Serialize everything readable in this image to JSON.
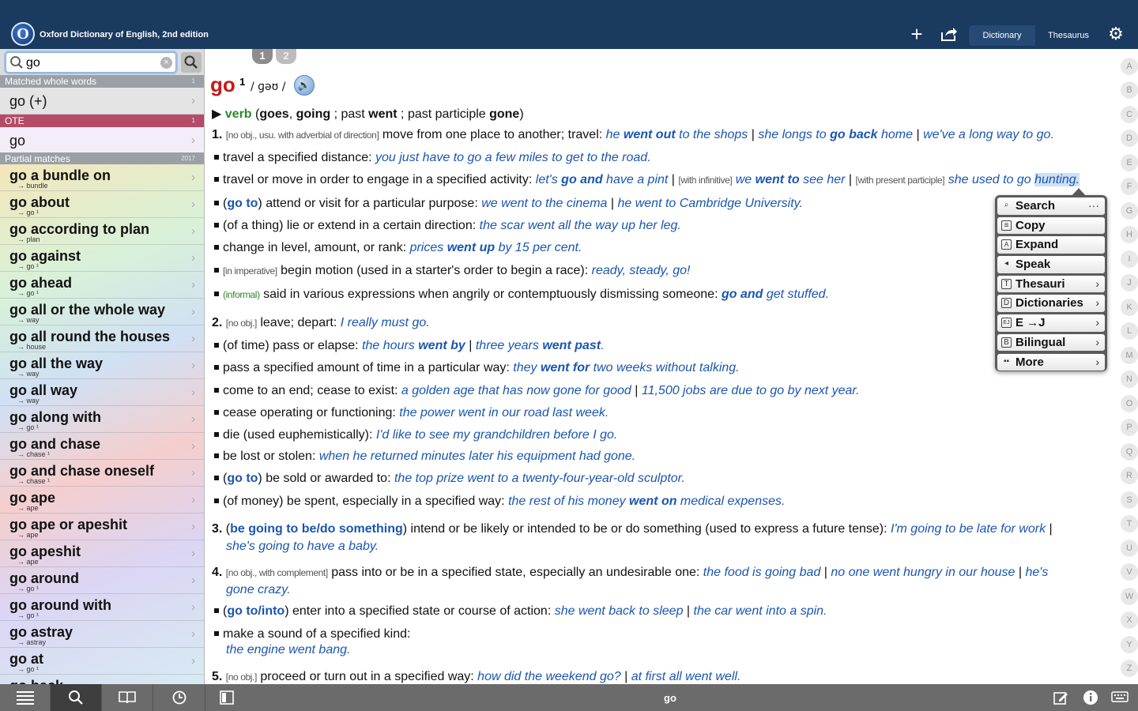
{
  "app": {
    "title": "Oxford Dictionary of English, 2nd edition",
    "logo_letter": "O"
  },
  "toolbar": {
    "tabs": [
      "Dictionary",
      "Thesaurus"
    ],
    "active_tab": "Dictionary"
  },
  "search": {
    "value": "go"
  },
  "sidebar": {
    "sections": [
      {
        "title": "Matched whole words",
        "count": "1",
        "color": "#9aa0a6"
      },
      {
        "title": "OTE",
        "count": "1",
        "color": "#b54b66"
      },
      {
        "title": "Partial matches",
        "count": "2017",
        "color": "#9aa0a6"
      }
    ],
    "matched": "go (+)",
    "ote": "go",
    "partial": [
      {
        "main": "go a bundle on",
        "sub": "→ bundle"
      },
      {
        "main": "go about",
        "sub": "→ go ¹"
      },
      {
        "main": "go according to plan",
        "sub": "→ plan"
      },
      {
        "main": "go against",
        "sub": "→ go ¹"
      },
      {
        "main": "go ahead",
        "sub": "→ go ¹"
      },
      {
        "main": "go all or the whole way",
        "sub": "→ way"
      },
      {
        "main": "go all round the houses",
        "sub": "→ house"
      },
      {
        "main": "go all the way",
        "sub": "→ way"
      },
      {
        "main": "go all way",
        "sub": "→ way"
      },
      {
        "main": "go along with",
        "sub": "→ go ¹"
      },
      {
        "main": "go and chase",
        "sub": "→ chase ¹"
      },
      {
        "main": "go and chase oneself",
        "sub": "→ chase ¹"
      },
      {
        "main": "go ape",
        "sub": "→ ape"
      },
      {
        "main": "go ape or apeshit",
        "sub": "→ ape"
      },
      {
        "main": "go apeshit",
        "sub": "→ ape"
      },
      {
        "main": "go around",
        "sub": "→ go ¹"
      },
      {
        "main": "go around with",
        "sub": "→ go ¹"
      },
      {
        "main": "go astray",
        "sub": "→ astray"
      },
      {
        "main": "go at",
        "sub": "→ go ¹"
      },
      {
        "main": "go back",
        "sub": ""
      }
    ]
  },
  "entry": {
    "pages": [
      "1",
      "2"
    ],
    "headword": "go",
    "homograph": "1",
    "pronunciation": "/ ɡəʊ /"
  },
  "context_menu": [
    {
      "label": "Search",
      "icon": "search-icon",
      "extra": "···"
    },
    {
      "label": "Copy",
      "icon": "copy-icon",
      "extra": ""
    },
    {
      "label": "Expand",
      "icon": "expand-icon",
      "extra": ""
    },
    {
      "label": "Speak",
      "icon": "speaker-icon",
      "extra": ""
    },
    {
      "label": "Thesauri",
      "icon": "thesaurus-icon",
      "extra": "›"
    },
    {
      "label": "Dictionaries",
      "icon": "dictionary-icon",
      "extra": "›"
    },
    {
      "label": "E →J",
      "icon": "ej-icon",
      "extra": "›"
    },
    {
      "label": "Bilingual",
      "icon": "bilingual-icon",
      "extra": "›"
    },
    {
      "label": "More",
      "icon": "more-icon",
      "extra": "›"
    }
  ],
  "alphabet": [
    "A",
    "B",
    "C",
    "D",
    "E",
    "F",
    "G",
    "H",
    "I",
    "J",
    "K",
    "L",
    "M",
    "N",
    "O",
    "P",
    "Q",
    "R",
    "S",
    "T",
    "U",
    "V",
    "W",
    "X",
    "Y",
    "Z"
  ],
  "bottom": {
    "current_word": "go"
  }
}
